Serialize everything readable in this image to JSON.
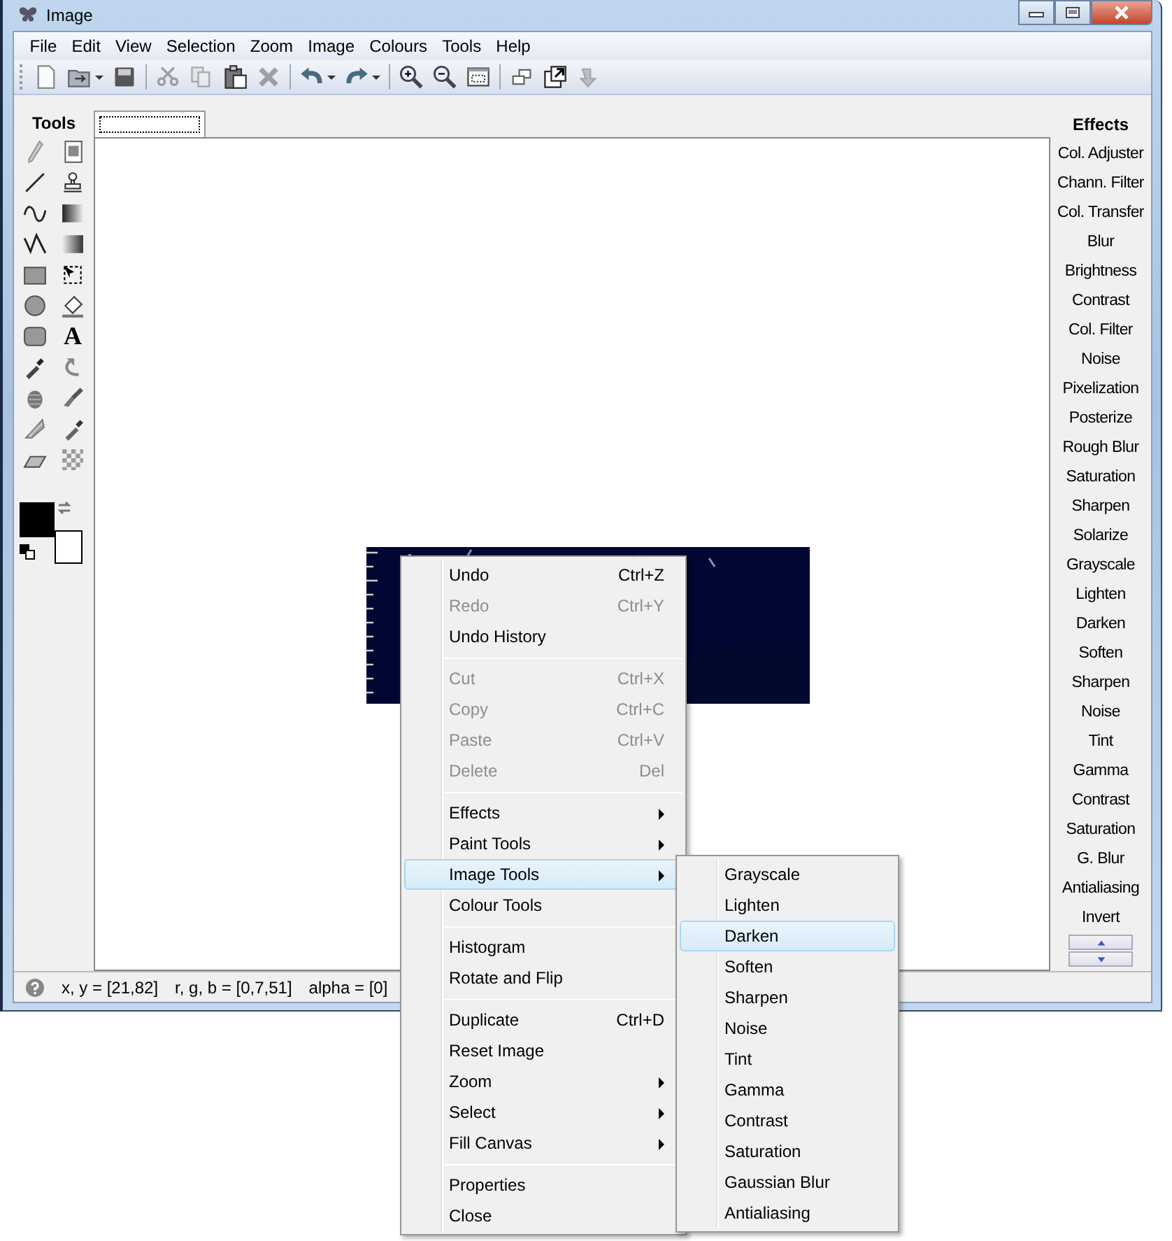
{
  "window": {
    "title": "Image"
  },
  "menu_bar": [
    "File",
    "Edit",
    "View",
    "Selection",
    "Zoom",
    "Image",
    "Colours",
    "Tools",
    "Help"
  ],
  "toolbar": [
    {
      "kind": "new",
      "disabled": false,
      "dropdown": false
    },
    {
      "kind": "open",
      "disabled": false,
      "dropdown": true
    },
    {
      "kind": "save",
      "disabled": false,
      "dropdown": false
    },
    {
      "kind": "separator"
    },
    {
      "kind": "cut",
      "disabled": true,
      "dropdown": false
    },
    {
      "kind": "copy",
      "disabled": true,
      "dropdown": false
    },
    {
      "kind": "paste",
      "disabled": false,
      "dropdown": false
    },
    {
      "kind": "delete",
      "disabled": true,
      "dropdown": false
    },
    {
      "kind": "separator"
    },
    {
      "kind": "undo",
      "disabled": false,
      "dropdown": true
    },
    {
      "kind": "redo",
      "disabled": false,
      "dropdown": true
    },
    {
      "kind": "separator"
    },
    {
      "kind": "zoomin",
      "disabled": false,
      "dropdown": false
    },
    {
      "kind": "zoomout",
      "disabled": false,
      "dropdown": false
    },
    {
      "kind": "fit",
      "disabled": false,
      "dropdown": false
    },
    {
      "kind": "separator"
    },
    {
      "kind": "windows",
      "disabled": false,
      "dropdown": false
    },
    {
      "kind": "popout",
      "disabled": false,
      "dropdown": false
    },
    {
      "kind": "arrow",
      "disabled": true,
      "dropdown": false
    }
  ],
  "tools_panel": {
    "title": "Tools",
    "text_tool": "A"
  },
  "color_swatches": [
    {
      "color": "#000000"
    },
    {
      "color": "#ffffff"
    }
  ],
  "effects_panel": {
    "title": "Effects",
    "items": [
      "Col. Adjuster",
      "Chann. Filter",
      "Col. Transfer",
      "Blur",
      "Brightness",
      "Contrast",
      "Col. Filter",
      "Noise",
      "Pixelization",
      "Posterize",
      "Rough Blur",
      "Saturation",
      "Sharpen",
      "Solarize",
      "Grayscale",
      "Lighten",
      "Darken",
      "Soften",
      "Sharpen",
      "Noise",
      "Tint",
      "Gamma",
      "Contrast",
      "Saturation",
      "G. Blur",
      "Antialiasing",
      "Invert"
    ]
  },
  "status_bar": {
    "coordinates": "x, y = [21,82]",
    "rgb": "r, g, b = [0,7,51]",
    "alpha": "alpha = [0]"
  },
  "context_menu": {
    "items": [
      {
        "kind": "item",
        "label": "Undo",
        "shortcut": "Ctrl+Z",
        "disabled": false,
        "selected": false,
        "submenu": false
      },
      {
        "kind": "item",
        "label": "Redo",
        "shortcut": "Ctrl+Y",
        "disabled": true,
        "selected": false,
        "submenu": false
      },
      {
        "kind": "item",
        "label": "Undo History",
        "disabled": false,
        "selected": false,
        "submenu": false
      },
      {
        "kind": "separator"
      },
      {
        "kind": "item",
        "label": "Cut",
        "shortcut": "Ctrl+X",
        "disabled": true,
        "selected": false,
        "submenu": false
      },
      {
        "kind": "item",
        "label": "Copy",
        "shortcut": "Ctrl+C",
        "disabled": true,
        "selected": false,
        "submenu": false
      },
      {
        "kind": "item",
        "label": "Paste",
        "shortcut": "Ctrl+V",
        "disabled": true,
        "selected": false,
        "submenu": false
      },
      {
        "kind": "item",
        "label": "Delete",
        "shortcut": "Del",
        "disabled": true,
        "selected": false,
        "submenu": false
      },
      {
        "kind": "separator"
      },
      {
        "kind": "item",
        "label": "Effects",
        "disabled": false,
        "selected": false,
        "submenu": true
      },
      {
        "kind": "item",
        "label": "Paint Tools",
        "disabled": false,
        "selected": false,
        "submenu": true
      },
      {
        "kind": "item",
        "label": "Image Tools",
        "disabled": false,
        "selected": true,
        "submenu": true
      },
      {
        "kind": "item",
        "label": "Colour Tools",
        "disabled": false,
        "selected": false,
        "submenu": false
      },
      {
        "kind": "separator"
      },
      {
        "kind": "item",
        "label": "Histogram",
        "disabled": false,
        "selected": false,
        "submenu": false
      },
      {
        "kind": "item",
        "label": "Rotate and Flip",
        "disabled": false,
        "selected": false,
        "submenu": false
      },
      {
        "kind": "separator"
      },
      {
        "kind": "item",
        "label": "Duplicate",
        "shortcut": "Ctrl+D",
        "disabled": false,
        "selected": false,
        "submenu": false
      },
      {
        "kind": "item",
        "label": "Reset Image",
        "disabled": false,
        "selected": false,
        "submenu": false
      },
      {
        "kind": "item",
        "label": "Zoom",
        "disabled": false,
        "selected": false,
        "submenu": true
      },
      {
        "kind": "item",
        "label": "Select",
        "disabled": false,
        "selected": false,
        "submenu": true
      },
      {
        "kind": "item",
        "label": "Fill Canvas",
        "disabled": false,
        "selected": false,
        "submenu": true
      },
      {
        "kind": "separator"
      },
      {
        "kind": "item",
        "label": "Properties",
        "disabled": false,
        "selected": false,
        "submenu": false
      },
      {
        "kind": "item",
        "label": "Close",
        "disabled": false,
        "selected": false,
        "submenu": false
      }
    ]
  },
  "submenu": {
    "items": [
      {
        "label": "Grayscale",
        "selected": false
      },
      {
        "label": "Lighten",
        "selected": false
      },
      {
        "label": "Darken",
        "selected": true
      },
      {
        "label": "Soften",
        "selected": false
      },
      {
        "label": "Sharpen",
        "selected": false
      },
      {
        "label": "Noise",
        "selected": false
      },
      {
        "label": "Tint",
        "selected": false
      },
      {
        "label": "Gamma",
        "selected": false
      },
      {
        "label": "Contrast",
        "selected": false
      },
      {
        "label": "Saturation",
        "selected": false
      },
      {
        "label": "Gaussian Blur",
        "selected": false
      },
      {
        "label": "Antialiasing",
        "selected": false
      }
    ]
  }
}
